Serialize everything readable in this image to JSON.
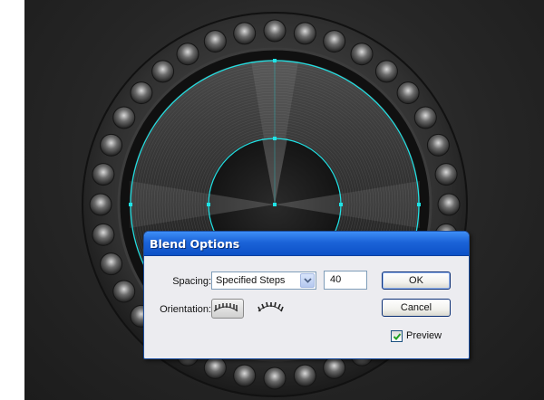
{
  "dialog": {
    "title": "Blend Options",
    "spacing": {
      "label": "Spacing:",
      "selected": "Specified Steps",
      "steps_value": "40"
    },
    "orientation": {
      "label": "Orientation:"
    },
    "ok_label": "OK",
    "cancel_label": "Cancel",
    "preview": {
      "label": "Preview",
      "checked": true
    }
  },
  "colors": {
    "selection_path": "#1fe3e6",
    "titlebar": "#1b63d8"
  },
  "icons": [
    "chevron-down-icon",
    "align-to-page-icon",
    "align-to-path-icon",
    "checkmark-icon"
  ]
}
